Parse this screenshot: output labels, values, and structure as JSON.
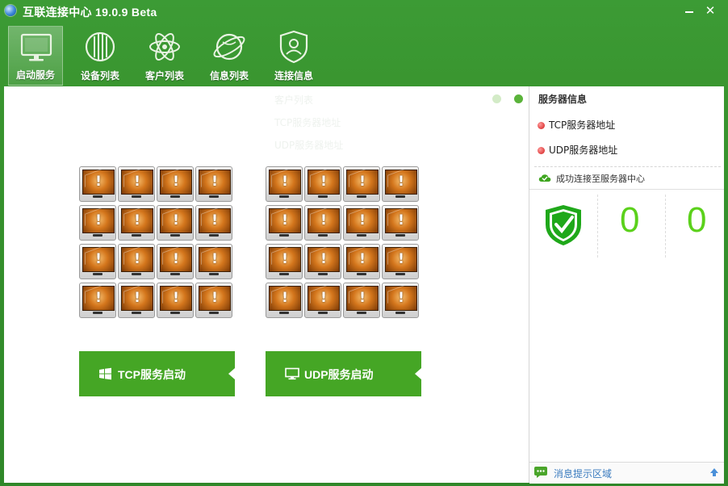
{
  "window": {
    "title": "互联连接中心 19.0.9 Beta",
    "minimize": "—",
    "close": "✕"
  },
  "toolbar": {
    "items": [
      {
        "label": "启动服务",
        "icon": "monitor-icon",
        "active": true
      },
      {
        "label": "设备列表",
        "icon": "device-list-icon",
        "active": false
      },
      {
        "label": "客户列表",
        "icon": "atom-icon",
        "active": false
      },
      {
        "label": "信息列表",
        "icon": "globe-icon",
        "active": false
      },
      {
        "label": "连接信息",
        "icon": "user-shield-icon",
        "active": false
      }
    ]
  },
  "main": {
    "faint_lines": [
      "客户列表",
      "TCP服务器地址",
      "UDP服务器地址"
    ],
    "tcp_button": {
      "label": "TCP服务启动",
      "icon": "windows-icon"
    },
    "udp_button": {
      "label": "UDP服务启动",
      "icon": "display-icon"
    },
    "device_grid": {
      "rows": 4,
      "cols": 4,
      "status": "warning"
    },
    "colors": {
      "accent": "#45a625",
      "monitor_screen": "#d4761c"
    }
  },
  "sidebar": {
    "title": "服务器信息",
    "tcp_label": "TCP服务器地址",
    "udp_label": "UDP服务器地址",
    "connection_status": "成功连接至服务器中心",
    "count_a": "0",
    "count_b": "0",
    "message_area_label": "消息提示区域",
    "colors": {
      "count": "#5bd11b",
      "bullet": "#d11a1a",
      "shield": "#1fa81a"
    }
  }
}
